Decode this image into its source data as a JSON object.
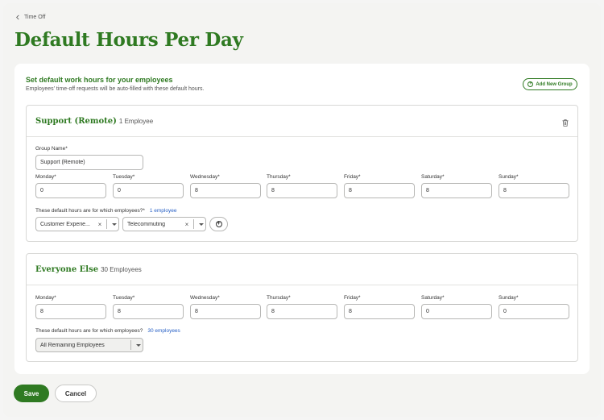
{
  "breadcrumb": {
    "back_label": "Time Off"
  },
  "page": {
    "title": "Default Hours Per Day"
  },
  "card": {
    "title": "Set default work hours for your employees",
    "subtitle": "Employees' time-off requests will be auto-filled with these default hours.",
    "add_group_label": "Add New Group"
  },
  "days": [
    "Monday*",
    "Tuesday*",
    "Wednesday*",
    "Thursday*",
    "Friday*",
    "Saturday*",
    "Sunday*"
  ],
  "groups": [
    {
      "name": "Support (Remote)",
      "count": "1 Employee",
      "group_name_label": "Group Name*",
      "group_name_value": "Support (Remote)",
      "hours": [
        "0",
        "0",
        "8",
        "8",
        "8",
        "8",
        "8"
      ],
      "employees_label": "These default hours are for which employees?*",
      "employees_link": "1 employee",
      "filters": [
        "Customer Experie...",
        "Telecommuting"
      ]
    },
    {
      "name": "Everyone Else",
      "count": "30 Employees",
      "hours": [
        "8",
        "8",
        "8",
        "8",
        "8",
        "0",
        "0"
      ],
      "employees_label": "These default hours are for which employees?",
      "employees_link": "30 employees",
      "filter": "All Remaining Employees"
    }
  ],
  "footer": {
    "save_label": "Save",
    "cancel_label": "Cancel"
  },
  "colors": {
    "brand_green": "#2f7a22",
    "link_blue": "#2760c5"
  }
}
